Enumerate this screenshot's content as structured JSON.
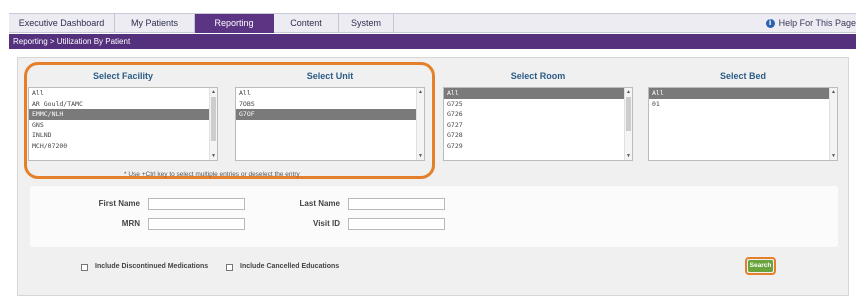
{
  "nav": {
    "tabs": [
      {
        "label": "Executive Dashboard"
      },
      {
        "label": "My Patients"
      },
      {
        "label": "Reporting"
      },
      {
        "label": "Content"
      },
      {
        "label": "System"
      }
    ],
    "active_tab": "Reporting",
    "help_label": "Help For This Page",
    "help_icon": "info-icon"
  },
  "breadcrumb": "Reporting > Utilization By Patient",
  "selectors": {
    "facility": {
      "label": "Select Facility",
      "options": [
        "All",
        "AR Gould/TAMC",
        "EMMC/NLH",
        "GNS",
        "INLND",
        "MCH/07200"
      ],
      "selected": "EMMC/NLH"
    },
    "unit": {
      "label": "Select Unit",
      "options": [
        "All",
        "7OBS",
        "G7OF"
      ],
      "selected": "G7OF"
    },
    "room": {
      "label": "Select Room",
      "options": [
        "All",
        "G725",
        "G726",
        "G727",
        "G728",
        "G729"
      ],
      "selected": "All"
    },
    "bed": {
      "label": "Select Bed",
      "options": [
        "All",
        "01"
      ],
      "selected": "All"
    }
  },
  "hint": "* Use +Ctrl key to select multiple entries or deselect the entry",
  "form": {
    "first_name": {
      "label": "First Name",
      "value": ""
    },
    "last_name": {
      "label": "Last Name",
      "value": ""
    },
    "mrn": {
      "label": "MRN",
      "value": ""
    },
    "visit_id": {
      "label": "Visit ID",
      "value": ""
    }
  },
  "options": {
    "discontinued_meds": "Include Discontinued Medications",
    "cancelled_educations": "Include Cancelled Educations"
  },
  "search_label": "Search",
  "colors": {
    "brand_purple": "#54307d",
    "highlight_orange": "#e47f2c",
    "label_blue": "#2b5c86",
    "search_green": "#68a33c"
  }
}
